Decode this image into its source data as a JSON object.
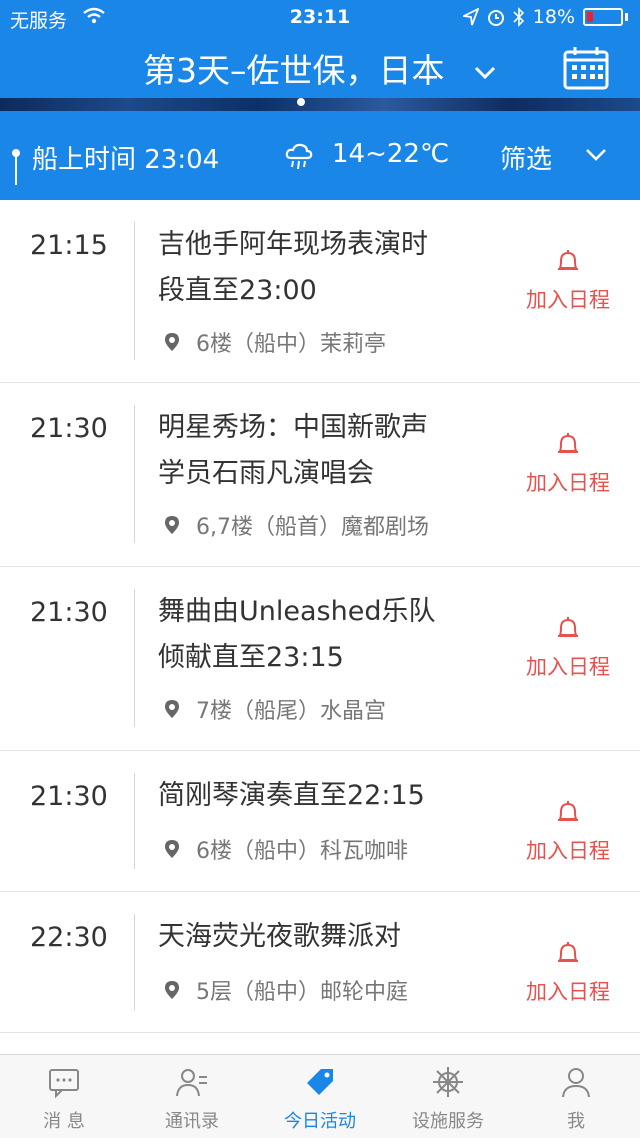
{
  "status_bar": {
    "carrier": "无服务",
    "time": "23:11",
    "battery": "18%"
  },
  "header": {
    "title": "第3天–佐世保，日本",
    "dropdown_icon": "chevron-down-icon",
    "calendar_icon": "calendar-icon"
  },
  "subbar": {
    "ship_time": "船上时间 23:04",
    "temperature": "14~22℃",
    "filter_label": "筛选"
  },
  "events": [
    {
      "time": "21:15",
      "title_lines": [
        "吉他手阿年现场表演时",
        "段直至23:00"
      ],
      "location": "6楼（船中）茉莉亭",
      "action": "加入日程"
    },
    {
      "time": "21:30",
      "title_lines": [
        "明星秀场：中国新歌声",
        "学员石雨凡演唱会"
      ],
      "location": "6,7楼（船首）魔都剧场",
      "action": "加入日程"
    },
    {
      "time": "21:30",
      "title_lines": [
        "舞曲由Unleashed乐队",
        "倾献直至23:15"
      ],
      "location": "7楼（船尾）水晶宫",
      "action": "加入日程"
    },
    {
      "time": "21:30",
      "title_lines": [
        "简刚琴演奏直至22:15"
      ],
      "location": "6楼（船中）科瓦咖啡",
      "action": "加入日程"
    },
    {
      "time": "22:30",
      "title_lines": [
        "天海荧光夜歌舞派对"
      ],
      "location": "5层（船中）邮轮中庭",
      "action": "加入日程"
    }
  ],
  "tabbar": {
    "tabs": [
      {
        "label": "消 息",
        "icon": "message-icon"
      },
      {
        "label": "通讯录",
        "icon": "contacts-icon"
      },
      {
        "label": "今日活动",
        "icon": "tag-icon",
        "active": true
      },
      {
        "label": "设施服务",
        "icon": "ship-wheel-icon"
      },
      {
        "label": "我",
        "icon": "user-icon"
      }
    ]
  },
  "colors": {
    "primary": "#1a86e8",
    "accent_red": "#e8524e"
  }
}
